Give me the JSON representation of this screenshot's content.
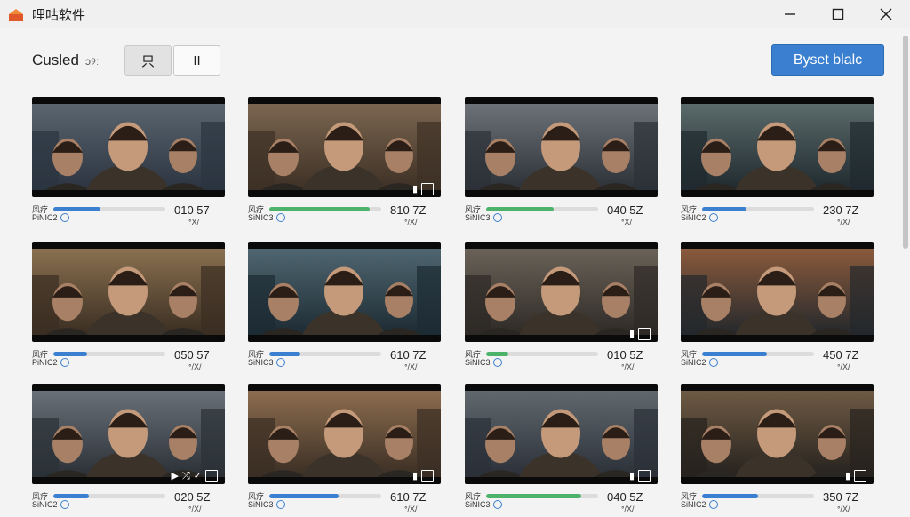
{
  "window": {
    "title": "哩咕软件"
  },
  "toolbar": {
    "sort_label": "Cusled",
    "sort_extra": "ɔ୨ː",
    "view_grid_label": "只",
    "view_list_label": "II",
    "primary_button": "Byset blalc"
  },
  "colors": {
    "accent": "#3a7fd0",
    "progress_blue": "#3a7fd0",
    "progress_green": "#4db36b"
  },
  "cards": [
    {
      "title": "风疗",
      "subtitle": "PiNIC2",
      "size": "010 57",
      "size_sub": "ᐤX/",
      "progress": 0.42,
      "progress_color": "#3a7fd0",
      "overlay": ""
    },
    {
      "title": "风疗",
      "subtitle": "SiNIC3",
      "size": "810 7Z",
      "size_sub": "ᐤ/X/",
      "progress": 0.9,
      "progress_color": "#4db36b",
      "overlay": "icon-frame"
    },
    {
      "title": "风疗",
      "subtitle": "SiNIC3",
      "size": "040 5Z",
      "size_sub": "ᐤX/",
      "progress": 0.6,
      "progress_color": "#4db36b",
      "overlay": ""
    },
    {
      "title": "风疗",
      "subtitle": "SiNIC2",
      "size": "230 7Z",
      "size_sub": "ᐤ/X/",
      "progress": 0.4,
      "progress_color": "#3a7fd0",
      "overlay": ""
    },
    {
      "title": "风疗",
      "subtitle": "PiNIC2",
      "size": "050 57",
      "size_sub": "ᐤ/X/",
      "progress": 0.3,
      "progress_color": "#3a7fd0",
      "overlay": ""
    },
    {
      "title": "风疗",
      "subtitle": "SiNIC3",
      "size": "610 7Z",
      "size_sub": "ᐤ/X/",
      "progress": 0.28,
      "progress_color": "#3a7fd0",
      "overlay": ""
    },
    {
      "title": "风疗",
      "subtitle": "SiNIC3",
      "size": "010 5Z",
      "size_sub": "ᐤ/X/",
      "progress": 0.2,
      "progress_color": "#4db36b",
      "overlay": "icon-frame"
    },
    {
      "title": "风疗",
      "subtitle": "SiNIC2",
      "size": "450 7Z",
      "size_sub": "ᐤ/X/",
      "progress": 0.58,
      "progress_color": "#3a7fd0",
      "overlay": ""
    },
    {
      "title": "风疗",
      "subtitle": "SiNIC2",
      "size": "020 5Z",
      "size_sub": "ᐤ/X/",
      "progress": 0.32,
      "progress_color": "#3a7fd0",
      "overlay": "icon-play"
    },
    {
      "title": "风疗",
      "subtitle": "SiNIC3",
      "size": "610 7Z",
      "size_sub": "ᐤ/X/",
      "progress": 0.62,
      "progress_color": "#3a7fd0",
      "overlay": "icon-frame"
    },
    {
      "title": "风疗",
      "subtitle": "SiNIC3",
      "size": "040 5Z",
      "size_sub": "ᐤ/X/",
      "progress": 0.85,
      "progress_color": "#4db36b",
      "overlay": "icon-frame"
    },
    {
      "title": "风疗",
      "subtitle": "SiNIC2",
      "size": "350 7Z",
      "size_sub": "ᐤ/X/",
      "progress": 0.5,
      "progress_color": "#3a7fd0",
      "overlay": "icon-frame"
    }
  ]
}
